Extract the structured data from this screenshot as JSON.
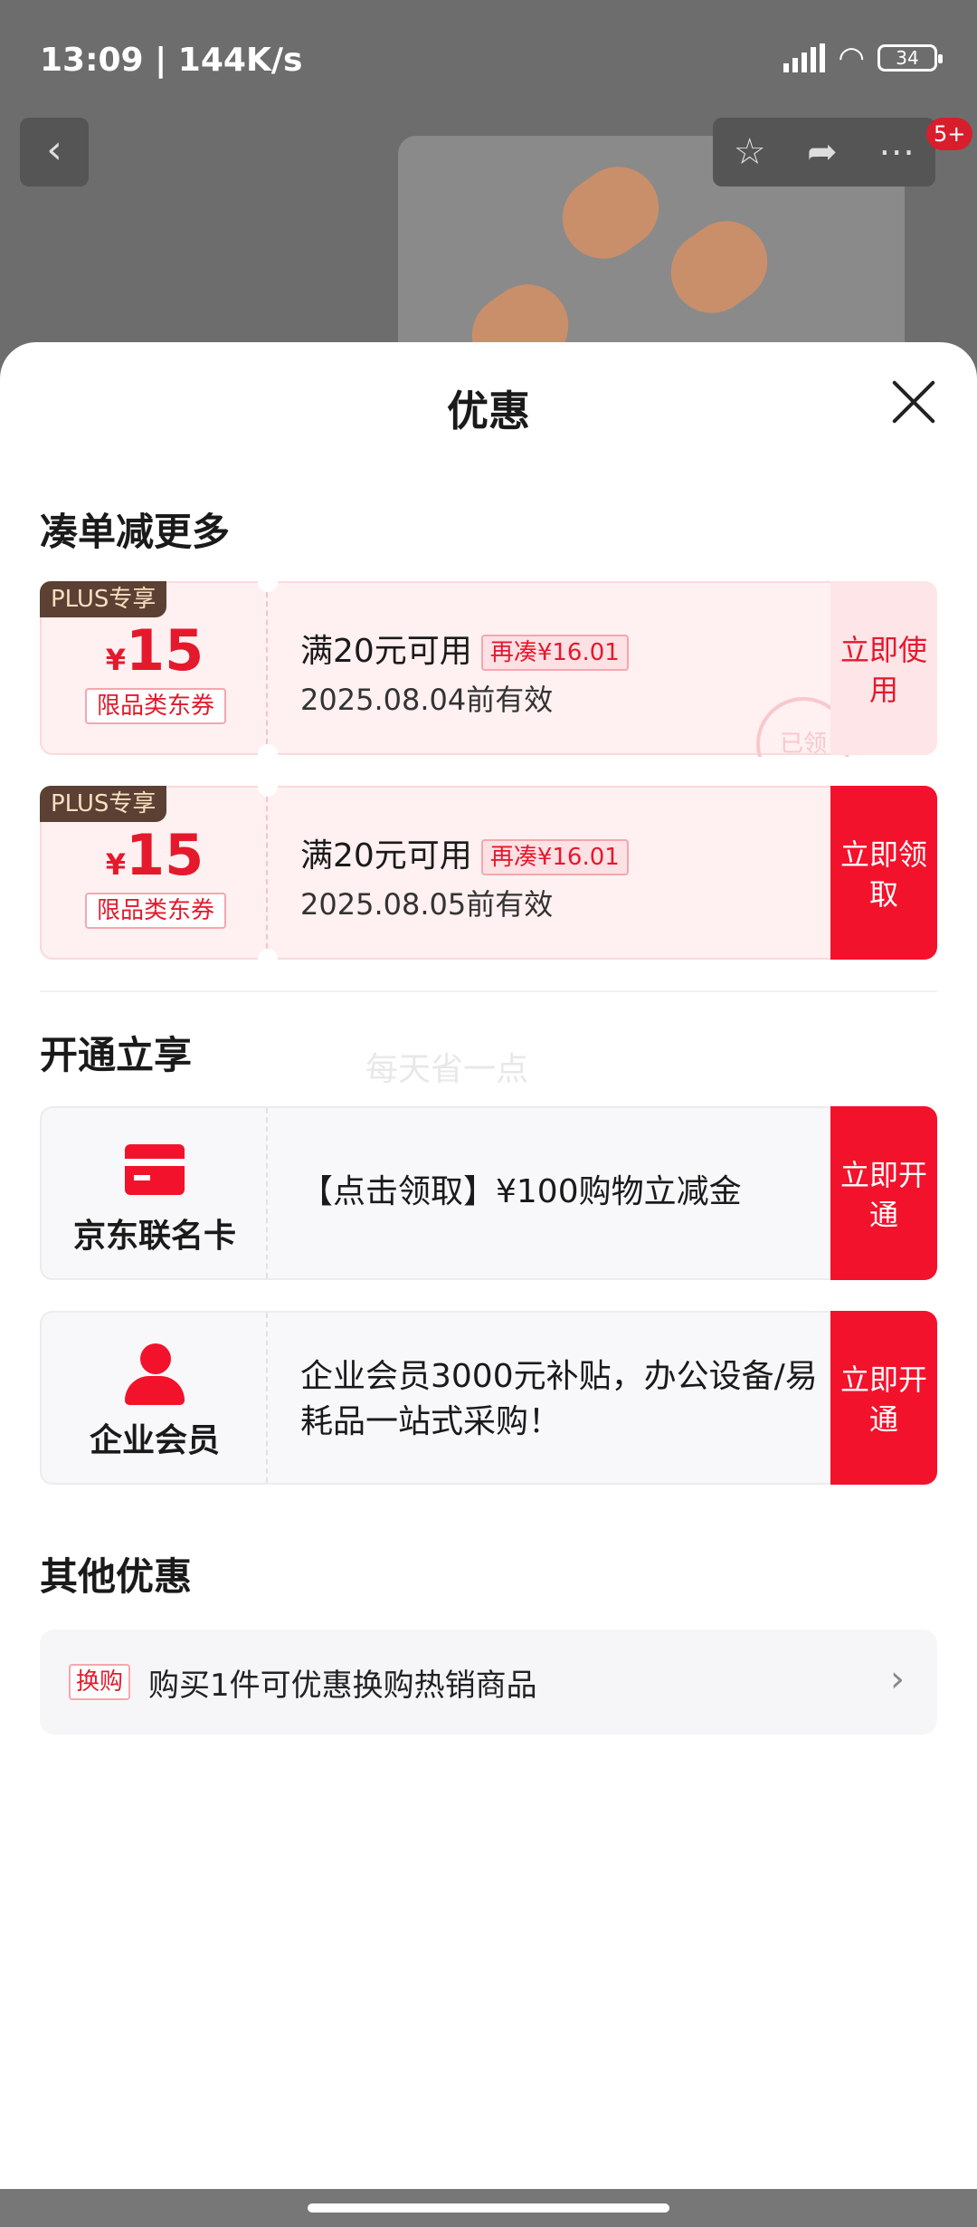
{
  "status_bar": {
    "time": "13:09 | 144K/s",
    "battery": "34"
  },
  "nav": {
    "back": "‹",
    "badge": "5+"
  },
  "sheet": {
    "title": "优惠",
    "section1": "凑单减更多",
    "coupons": [
      {
        "plus": "PLUS专享",
        "symbol": "¥",
        "amount": "15",
        "category": "限品类东券",
        "condition": "满20元可用",
        "tag": "再凑¥16.01",
        "expire": "2025.08.04前有效",
        "action": "立即使用",
        "stamp": "已领"
      },
      {
        "plus": "PLUS专享",
        "symbol": "¥",
        "amount": "15",
        "category": "限品类东券",
        "condition": "满20元可用",
        "tag": "再凑¥16.01",
        "expire": "2025.08.05前有效",
        "action": "立即领取"
      }
    ],
    "section2": "开通立享",
    "watermark": "每天省一点",
    "open_cards": [
      {
        "label": "京东联名卡",
        "desc": "【点击领取】¥100购物立减金",
        "action": "立即开通",
        "icon": "credit-card-icon"
      },
      {
        "label": "企业会员",
        "desc": " 企业会员3000元补贴，办公设备/易耗品一站式采购！",
        "action": "立即开通",
        "icon": "person-icon"
      }
    ],
    "section3": "其他优惠",
    "other": {
      "tag": "换购",
      "text": "购买1件可优惠换购热销商品"
    }
  },
  "colors": {
    "accent": "#f3122c",
    "plus_bg": "#5c4033"
  }
}
